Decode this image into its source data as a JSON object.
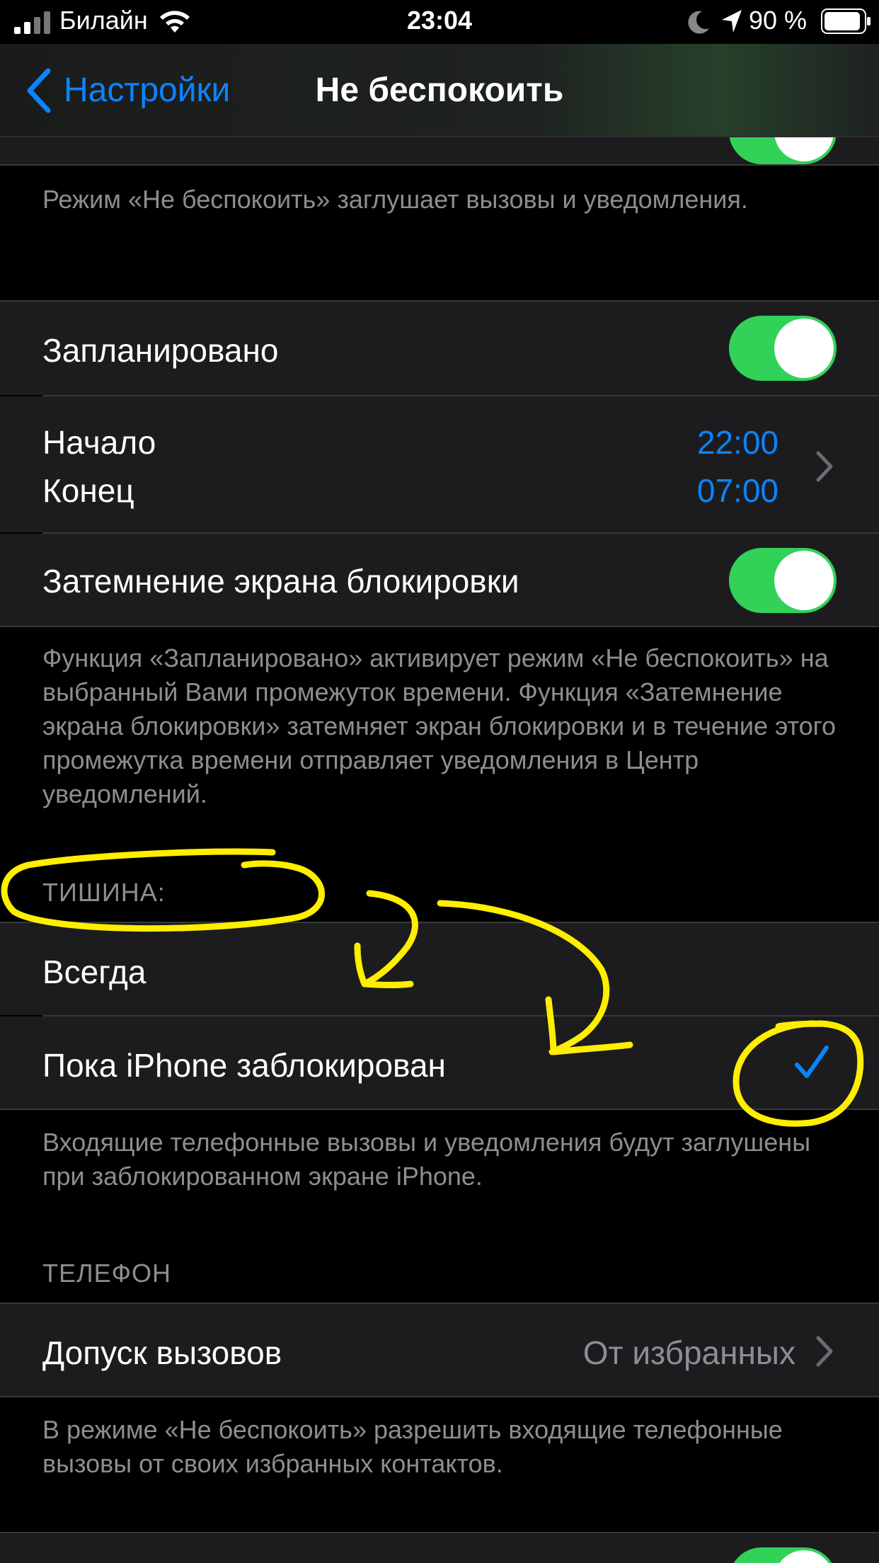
{
  "status_bar": {
    "carrier": "Билайн",
    "time": "23:04",
    "battery": "90 %"
  },
  "nav": {
    "back_label": "Настройки",
    "title": "Не беспокоить"
  },
  "dnd_footer": "Режим «Не беспокоить» заглушает вызовы и уведомления.",
  "scheduled": {
    "label": "Запланировано",
    "on": true,
    "start_label": "Начало",
    "start_value": "22:00",
    "end_label": "Конец",
    "end_value": "07:00",
    "dim_label": "Затемнение экрана блокировки",
    "dim_on": true,
    "footer": "Функция «Запланировано» активирует режим «Не беспокоить» на выбранный Вами промежуток времени. Функция «Затемнение экрана блокировки» затемняет экран блокировки и в течение этого промежутка времени отправляет уведомления в Центр уведомлений."
  },
  "silence": {
    "header": "ТИШИНА:",
    "always_label": "Всегда",
    "locked_label": "Пока iPhone заблокирован",
    "locked_checked": true,
    "footer": "Входящие телефонные вызовы и уведомления будут заглушены при заблокированном экране iPhone."
  },
  "phone": {
    "header": "ТЕЛЕФОН",
    "allow_calls_label": "Допуск вызовов",
    "allow_calls_value": "От избранных",
    "footer": "В режиме «Не беспокоить» разрешить входящие телефонные вызовы от своих избранных контактов."
  },
  "colors": {
    "accent": "#0a84ff",
    "switch_on": "#32d158",
    "annotation": "#ffee00"
  }
}
